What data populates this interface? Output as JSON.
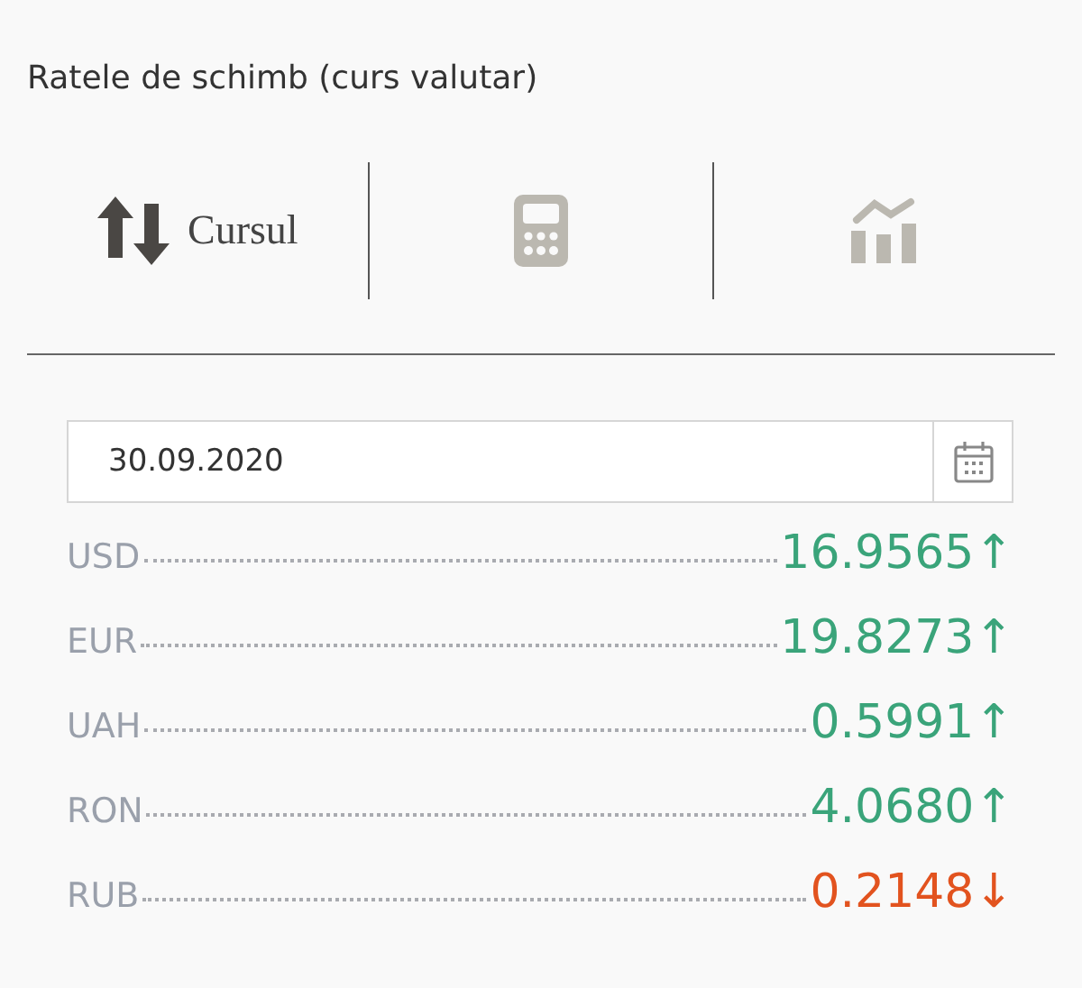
{
  "title": "Ratele de schimb (curs valutar)",
  "tabs": [
    {
      "kind": "rates",
      "label": "Cursul",
      "selected": true
    },
    {
      "kind": "calculator",
      "selected": false
    },
    {
      "kind": "chart",
      "selected": false
    }
  ],
  "date_field": {
    "value": "30.09.2020"
  },
  "rates": [
    {
      "code": "USD",
      "value": "16.9565",
      "arrow": "↑",
      "kind": "up"
    },
    {
      "code": "EUR",
      "value": "19.8273",
      "arrow": "↑",
      "kind": "up"
    },
    {
      "code": "UAH",
      "value": "0.5991",
      "arrow": "↑",
      "kind": "up"
    },
    {
      "code": "RON",
      "value": "4.0680",
      "arrow": "↑",
      "kind": "up"
    },
    {
      "code": "RUB",
      "value": "0.2148",
      "arrow": "↓",
      "kind": "down"
    }
  ]
}
